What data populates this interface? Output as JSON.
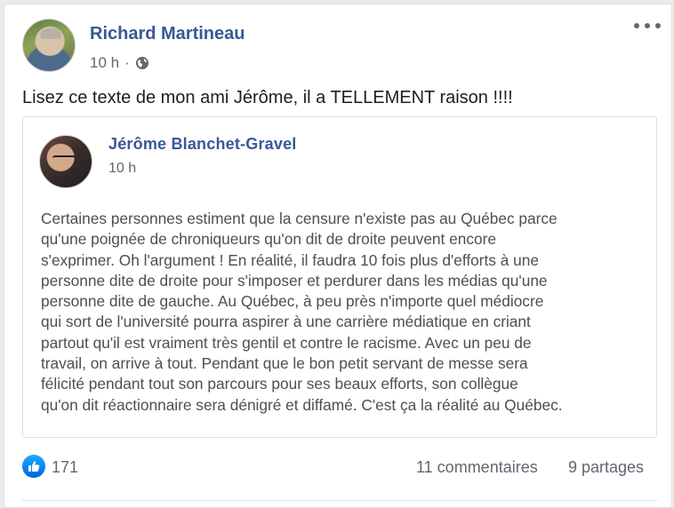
{
  "post": {
    "author": "Richard Martineau",
    "timestamp": "10 h",
    "separator": "·",
    "audience_icon": "globe-icon",
    "more_icon": "more-options-icon",
    "text": "Lisez ce texte de mon ami Jérôme, il a TELLEMENT raison !!!!"
  },
  "shared_post": {
    "author": "Jérôme Blanchet-Gravel",
    "timestamp": "10 h",
    "body_lines": [
      "Certaines personnes estiment que la censure n'existe pas au Québec parce",
      "qu'une poignée de chroniqueurs qu'on dit de droite peuvent encore",
      "s'exprimer. Oh l'argument ! En réalité, il faudra 10 fois plus d'efforts à une",
      "personne dite de droite pour s'imposer et perdurer dans les médias qu'une",
      "personne dite de gauche. Au Québec, à peu près n'importe quel médiocre",
      "qui sort de l'université pourra aspirer à une carrière médiatique en criant",
      "partout qu'il est vraiment très gentil et contre le racisme. Avec un peu de",
      "travail, on arrive à tout. Pendant que le bon petit servant de messe sera",
      "félicité pendant tout son parcours pour ses beaux efforts, son collègue",
      "qu'on dit réactionnaire sera dénigré et diffamé. C'est ça la réalité au Québec."
    ]
  },
  "footer": {
    "reaction_icon": "like-icon",
    "reaction_count": "171",
    "comments": "11 commentaires",
    "shares": "9 partages"
  },
  "colors": {
    "link_blue": "#385898",
    "like_blue": "#0062df",
    "secondary_text": "#606770"
  }
}
